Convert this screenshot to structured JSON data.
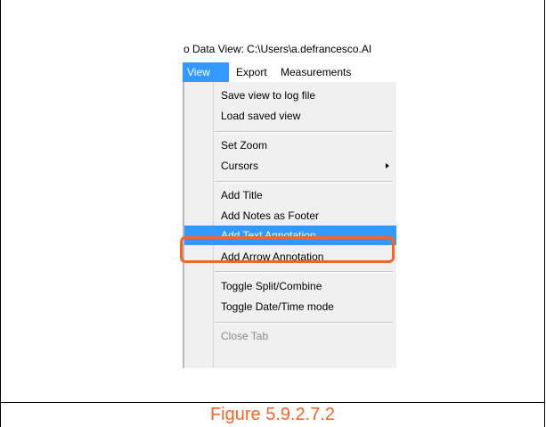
{
  "screenshot": {
    "title": "o Data View: C:\\Users\\a.defrancesco.AI",
    "menubar": {
      "view": "View",
      "export": "Export",
      "measurements": "Measurements"
    },
    "menu_items": {
      "save_view": "Save view to log file",
      "load_view": "Load saved view",
      "set_zoom": "Set Zoom",
      "cursors": "Cursors",
      "add_title": "Add Title",
      "add_notes": "Add Notes as Footer",
      "add_text_annotation": "Add Text Annotation",
      "add_arrow_annotation": "Add Arrow Annotation",
      "toggle_split": "Toggle Split/Combine",
      "toggle_datetime": "Toggle Date/Time mode",
      "close_tab": "Close Tab"
    }
  },
  "caption": "Figure 5.9.2.7.2",
  "colors": {
    "highlight": "#3399ff",
    "callout": "#f0672a",
    "menu_bg": "#f0f0f0"
  }
}
